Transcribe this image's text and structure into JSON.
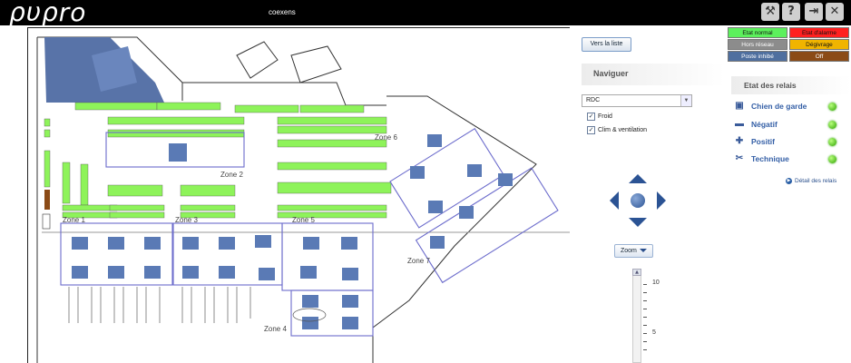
{
  "header": {
    "logo": "ρυρro",
    "site_name": "coexens",
    "icons": [
      {
        "name": "tools-icon",
        "glyph": "⚒"
      },
      {
        "name": "help-icon",
        "glyph": "?"
      },
      {
        "name": "door-exit-icon",
        "glyph": "⇥"
      },
      {
        "name": "close-icon",
        "glyph": "✕"
      }
    ]
  },
  "plan": {
    "zones": [
      {
        "label": "Zone 1"
      },
      {
        "label": "Zone 2"
      },
      {
        "label": "Zone 3"
      },
      {
        "label": "Zone 4"
      },
      {
        "label": "Zone 5"
      },
      {
        "label": "Zone 6"
      },
      {
        "label": "Zone 7"
      }
    ],
    "colors": {
      "normal": "#8ef35a",
      "unit": "#5a7ab5",
      "zone_outline": "#6c6ccc",
      "building": "#5873a8"
    }
  },
  "nav": {
    "list_button": "Vers la liste",
    "title": "Naviguer",
    "floor": "RDC",
    "checks": [
      {
        "label": "Froid",
        "checked": true
      },
      {
        "label": "Clim & ventilation",
        "checked": true
      }
    ],
    "zoom_label": "Zoom",
    "zoom_scale": [
      "10",
      "5"
    ]
  },
  "legend": [
    {
      "label": "Etat normal",
      "bg": "#5cf05c",
      "fg": "#111"
    },
    {
      "label": "Etat d'alarme",
      "bg": "#ff2020",
      "fg": "#111"
    },
    {
      "label": "Hors réseau",
      "bg": "#8c8c8c",
      "fg": "#fff"
    },
    {
      "label": "Dégivrage",
      "bg": "#f0b400",
      "fg": "#111"
    },
    {
      "label": "Poste inhibé",
      "bg": "#4f6f9f",
      "fg": "#fff"
    },
    {
      "label": "Off",
      "bg": "#8b4b16",
      "fg": "#fff"
    }
  ],
  "relais": {
    "title": "Etat des relais",
    "items": [
      {
        "label": "Chien de garde",
        "icon": "▣",
        "status_color": "#2da300"
      },
      {
        "label": "Négatif",
        "icon": "▬",
        "status_color": "#2da300"
      },
      {
        "label": "Positif",
        "icon": "✚",
        "status_color": "#2da300"
      },
      {
        "label": "Technique",
        "icon": "✂",
        "status_color": "#2da300"
      }
    ],
    "detail_link": "Détail des relais"
  }
}
